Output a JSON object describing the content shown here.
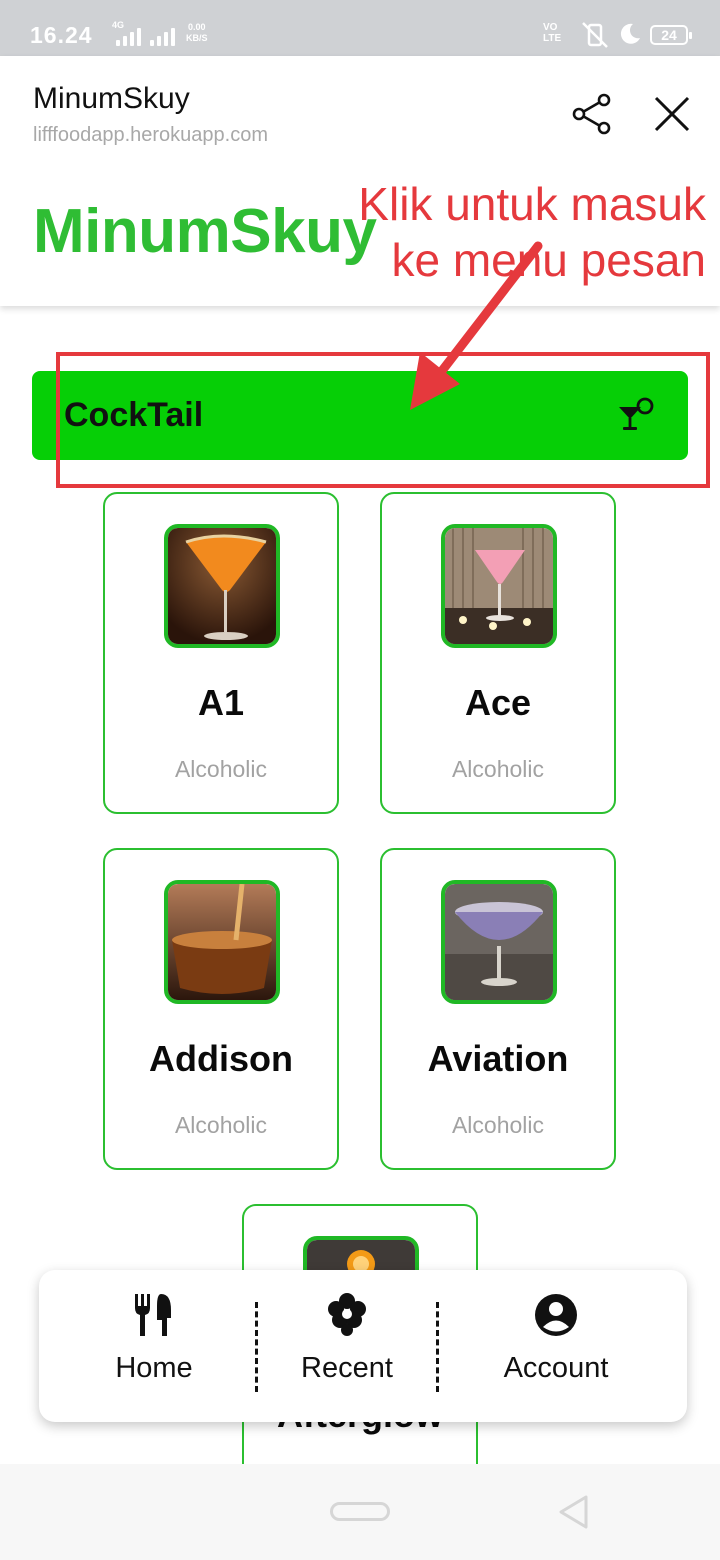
{
  "status_bar": {
    "time": "16.24",
    "network_speed_value": "0.00",
    "network_speed_unit": "KB/S",
    "network_type": "4G",
    "volte": "VO LTE",
    "battery": "24"
  },
  "header": {
    "site_title": "MinumSkuy",
    "site_url": "lifffoodapp.herokuapp.com",
    "brand_title": "MinumSkuy"
  },
  "annotation": {
    "line1": "Klik untuk masuk",
    "line2": "ke menu pesan",
    "color": "#e5393d"
  },
  "category_bar": {
    "label": "CockTail",
    "icon": "cocktail-icon",
    "color": "#06cf06"
  },
  "drinks": [
    {
      "name": "A1",
      "category": "Alcoholic"
    },
    {
      "name": "Ace",
      "category": "Alcoholic"
    },
    {
      "name": "Addison",
      "category": "Alcoholic"
    },
    {
      "name": "Aviation",
      "category": "Alcoholic"
    },
    {
      "name": "Afterglow",
      "category": ""
    }
  ],
  "bottom_nav": {
    "items": [
      {
        "label": "Home",
        "icon": "fork-knife-icon"
      },
      {
        "label": "Recent",
        "icon": "cloud-icon"
      },
      {
        "label": "Account",
        "icon": "account-circle-icon"
      }
    ]
  },
  "colors": {
    "brand_green": "#2fbd34",
    "card_border": "#2bbf30"
  }
}
